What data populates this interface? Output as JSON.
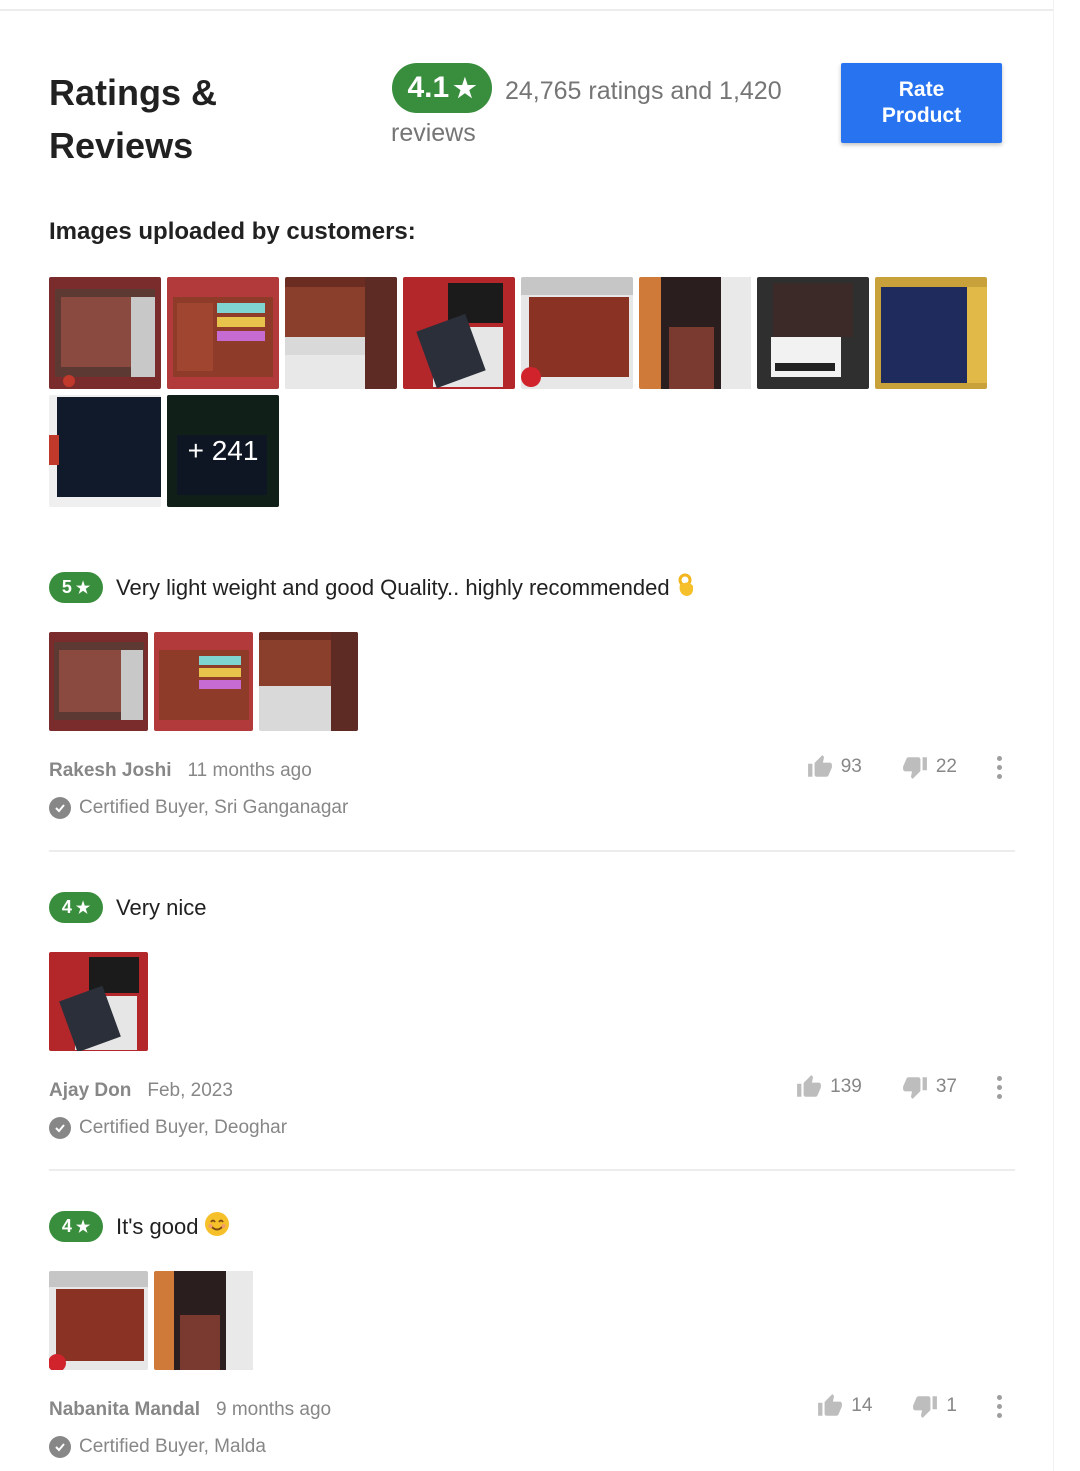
{
  "header": {
    "title": "Ratings & Reviews",
    "rating_value": "4.1",
    "star_glyph": "★",
    "summary": "24,765 ratings and 1,420 reviews",
    "rate_button": "Rate Product"
  },
  "uploads": {
    "heading": "Images uploaded by customers:",
    "more_count": "+ 241"
  },
  "reviews": [
    {
      "rating": "5",
      "title": "Very light weight and good Quality.. highly recommended",
      "author": "Rakesh Joshi",
      "when": "11 months ago",
      "certified": "Certified Buyer, Sri Ganganagar",
      "likes": "93",
      "dislikes": "22",
      "emoji": "ok-hand"
    },
    {
      "rating": "4",
      "title": "Very nice",
      "author": "Ajay Don",
      "when": "Feb, 2023",
      "certified": "Certified Buyer, Deoghar",
      "likes": "139",
      "dislikes": "37",
      "emoji": ""
    },
    {
      "rating": "4",
      "title": "It's good",
      "author": "Nabanita Mandal",
      "when": "9 months ago",
      "certified": "Certified Buyer, Malda",
      "likes": "14",
      "dislikes": "1",
      "emoji": "smiling-face"
    }
  ],
  "colors": {
    "rating_green": "#388e3c",
    "button_blue": "#2874f0",
    "muted_text": "#878787"
  }
}
